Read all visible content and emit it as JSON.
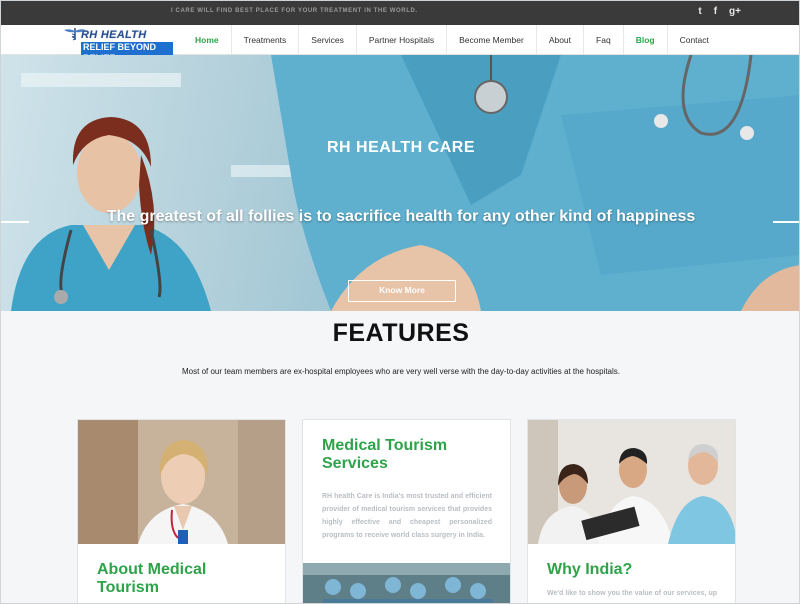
{
  "topbar": {
    "tagline": "I CARE WILL FIND BEST PLACE FOR YOUR TREATMENT IN THE WORLD.",
    "social": [
      {
        "icon": "twitter-icon",
        "glyph": "t"
      },
      {
        "icon": "facebook-icon",
        "glyph": "f"
      },
      {
        "icon": "google-plus-icon",
        "glyph": "g+"
      }
    ]
  },
  "logo": {
    "line1": "RH HEALTH CARE",
    "line2": "RELIEF BEYOND BELIEF"
  },
  "nav": {
    "items": [
      {
        "label": "Home"
      },
      {
        "label": "Treatments"
      },
      {
        "label": "Services"
      },
      {
        "label": "Partner Hospitals"
      },
      {
        "label": "Become Member"
      },
      {
        "label": "About"
      },
      {
        "label": "Faq"
      },
      {
        "label": "Blog"
      },
      {
        "label": "Contact"
      }
    ]
  },
  "hero": {
    "title": "RH HEALTH CARE",
    "quote": "The greatest of all follies is to sacrifice health for any other kind of happiness",
    "button": "Know More"
  },
  "features": {
    "heading": "FEATURES",
    "subtitle": "Most of our team members are ex-hospital employees who are very well verse with the day-to-day activities at the hospitals.",
    "cards": [
      {
        "title": "About Medical Tourism",
        "body": ""
      },
      {
        "title": "Medical Tourism Services",
        "body": "RH health Care is India's most trusted and efficient provider of medical tourism services that provides highly effective and cheapest personalized programs to receive world class surgery in India."
      },
      {
        "title": "Why India?",
        "body": "We'd like to show you the value of our services, up front, to help you understand the importance"
      }
    ]
  },
  "colors": {
    "accent_green": "#2fa34a",
    "topbar_bg": "#3a3a3a",
    "logo_blue": "#1f6fd1"
  }
}
